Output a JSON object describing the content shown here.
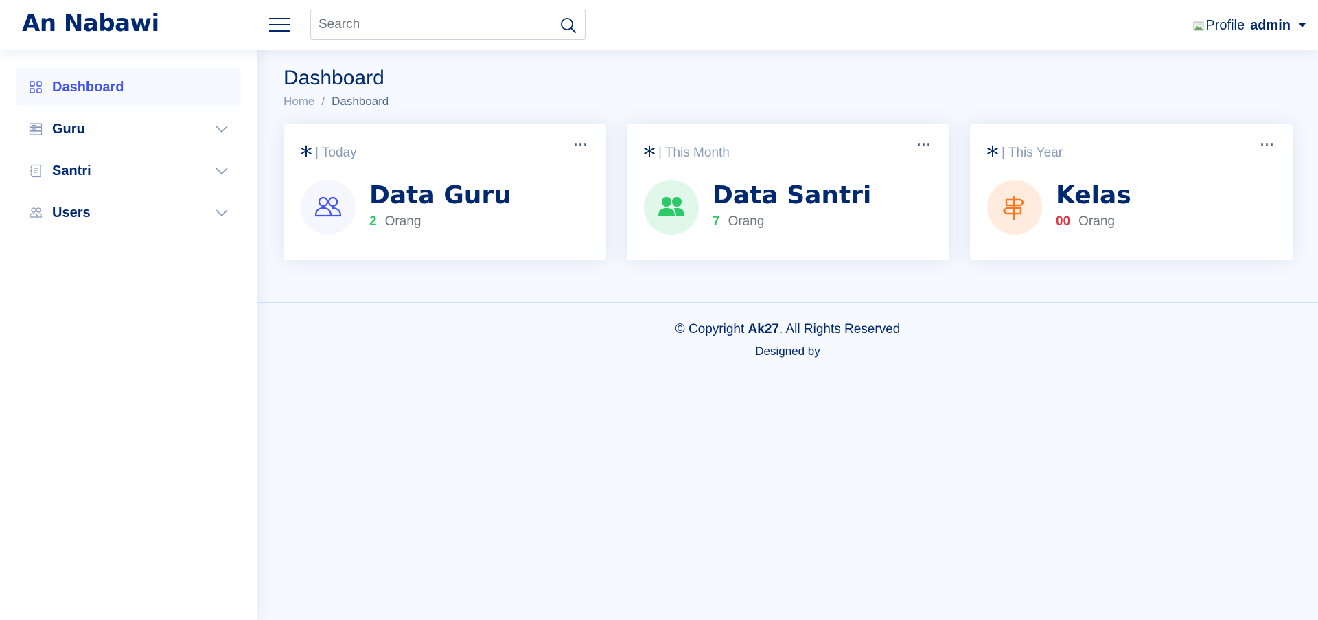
{
  "app": {
    "logo": "An Nabawi"
  },
  "header": {
    "search_placeholder": "Search",
    "profile_alt": "Profile",
    "user_name": "admin"
  },
  "sidebar": {
    "items": [
      {
        "label": "Dashboard",
        "icon": "grid-icon",
        "active": true
      },
      {
        "label": "Guru",
        "icon": "server-icon",
        "expandable": true
      },
      {
        "label": "Santri",
        "icon": "document-icon",
        "expandable": true
      },
      {
        "label": "Users",
        "icon": "people-icon",
        "expandable": true
      }
    ]
  },
  "page": {
    "title": "Dashboard",
    "breadcrumb": {
      "home": "Home",
      "sep": "/",
      "current": "Dashboard"
    }
  },
  "cards": [
    {
      "filter": "| Today",
      "title": "Data Guru",
      "count": "2",
      "unit": "Orang",
      "icon": "people-outline-icon",
      "count_color": "#2eca6a",
      "circle_color": "#f6f6fe",
      "icon_color": "#4154f1"
    },
    {
      "filter": "| This Month",
      "title": "Data Santri",
      "count": "7",
      "unit": "Orang",
      "icon": "people-fill-icon",
      "count_color": "#2eca6a",
      "circle_color": "#e0f8e9",
      "icon_color": "#2eca6a"
    },
    {
      "filter": "| This Year",
      "title": "Kelas",
      "count": "00",
      "unit": "Orang",
      "icon": "signpost-icon",
      "count_color": "#dc3545",
      "circle_color": "#ffecdf",
      "icon_color": "#ff771d"
    }
  ],
  "card_ui": {
    "asterisk": "*",
    "more": "···"
  },
  "footer": {
    "copyright_prefix": "© Copyright ",
    "copyright_brand": "Ak27",
    "copyright_suffix": ". All Rights Reserved",
    "designed_by": "Designed by"
  }
}
